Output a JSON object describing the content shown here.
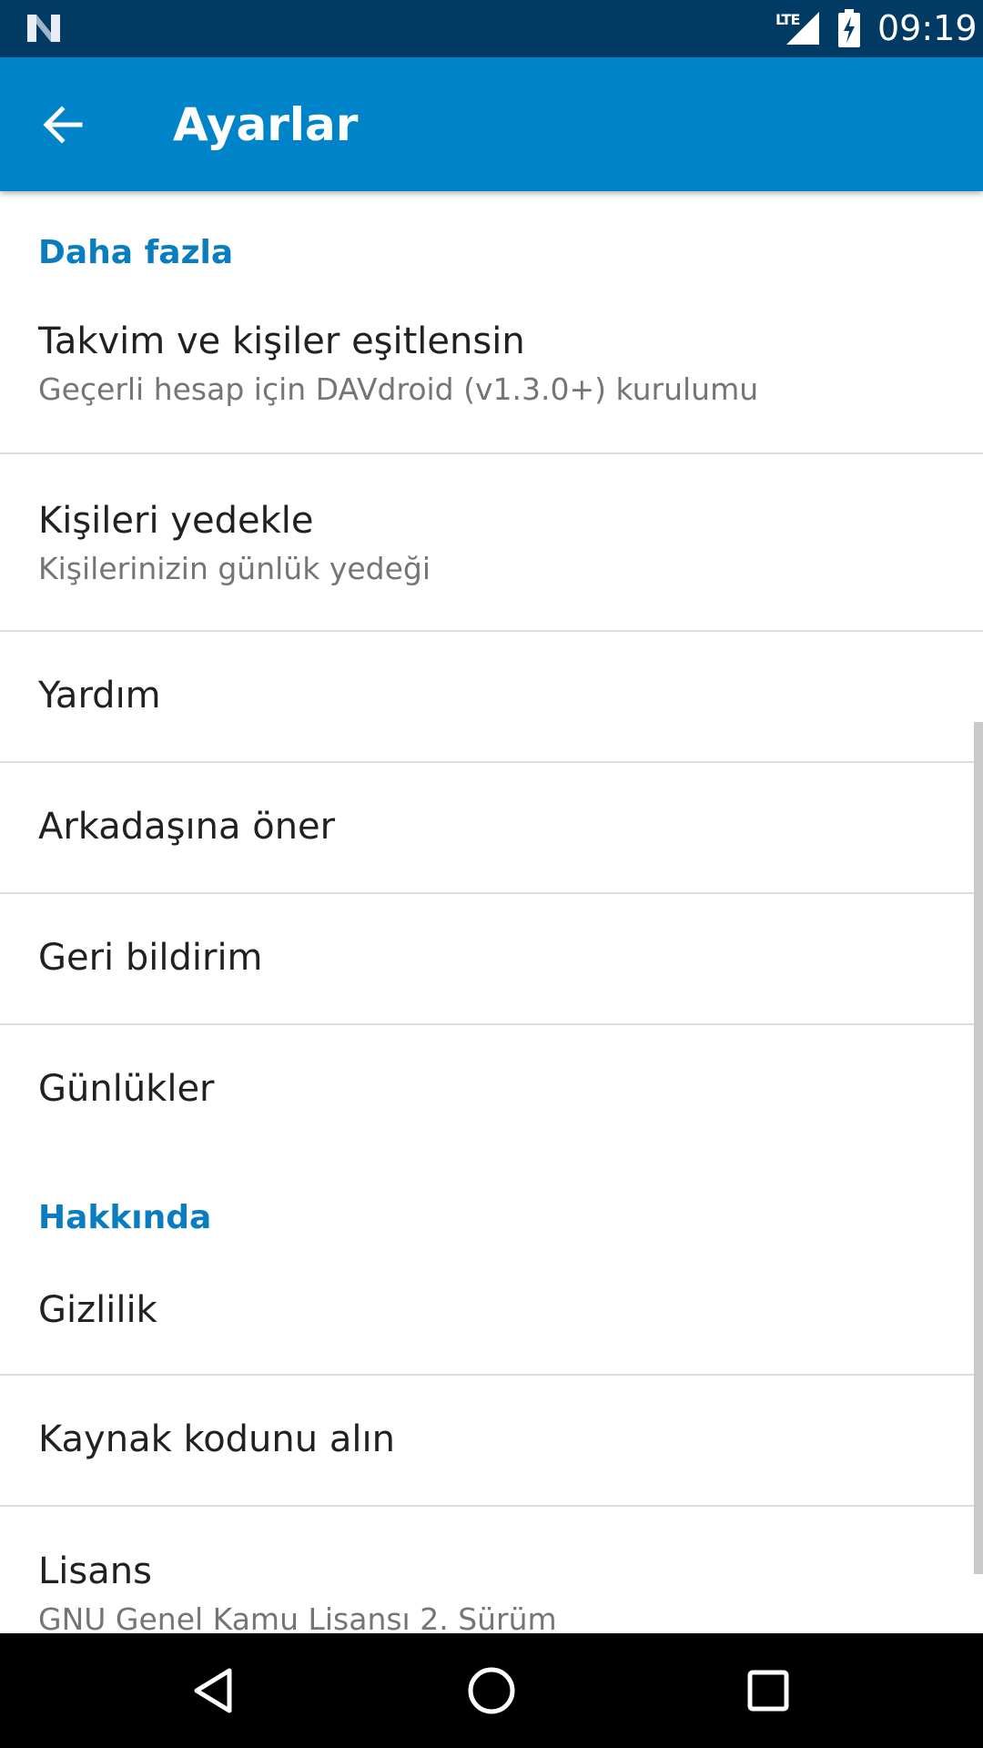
{
  "status_bar": {
    "network_type": "LTE",
    "time": "09:19",
    "icons": [
      "notification-n-icon",
      "signal-icon",
      "battery-charging-icon"
    ]
  },
  "app_bar": {
    "title": "Ayarlar",
    "back_icon": "arrow-back-icon",
    "color": "#0084c9"
  },
  "sections": [
    {
      "header": "Daha fazla",
      "items": [
        {
          "title": "Takvim ve kişiler eşitlensin",
          "summary": "Geçerli hesap için DAVdroid (v1.3.0+) kurulumu"
        },
        {
          "title": "Kişileri yedekle",
          "summary": "Kişilerinizin günlük yedeği"
        },
        {
          "title": "Yardım"
        },
        {
          "title": "Arkadaşına öner"
        },
        {
          "title": "Geri bildirim"
        },
        {
          "title": "Günlükler"
        }
      ]
    },
    {
      "header": "Hakkında",
      "items": [
        {
          "title": "Gizlilik"
        },
        {
          "title": "Kaynak kodunu alın"
        },
        {
          "title": "Lisans",
          "summary": "GNU Genel Kamu Lisansı 2. Sürüm"
        }
      ]
    }
  ],
  "nav_bar": {
    "buttons": [
      "back-triangle-icon",
      "home-circle-icon",
      "recents-square-icon"
    ]
  },
  "colors": {
    "status_bar": "#013b63",
    "accent": "#0a7cc0",
    "primary_text": "#212121",
    "secondary_text": "#757575"
  }
}
